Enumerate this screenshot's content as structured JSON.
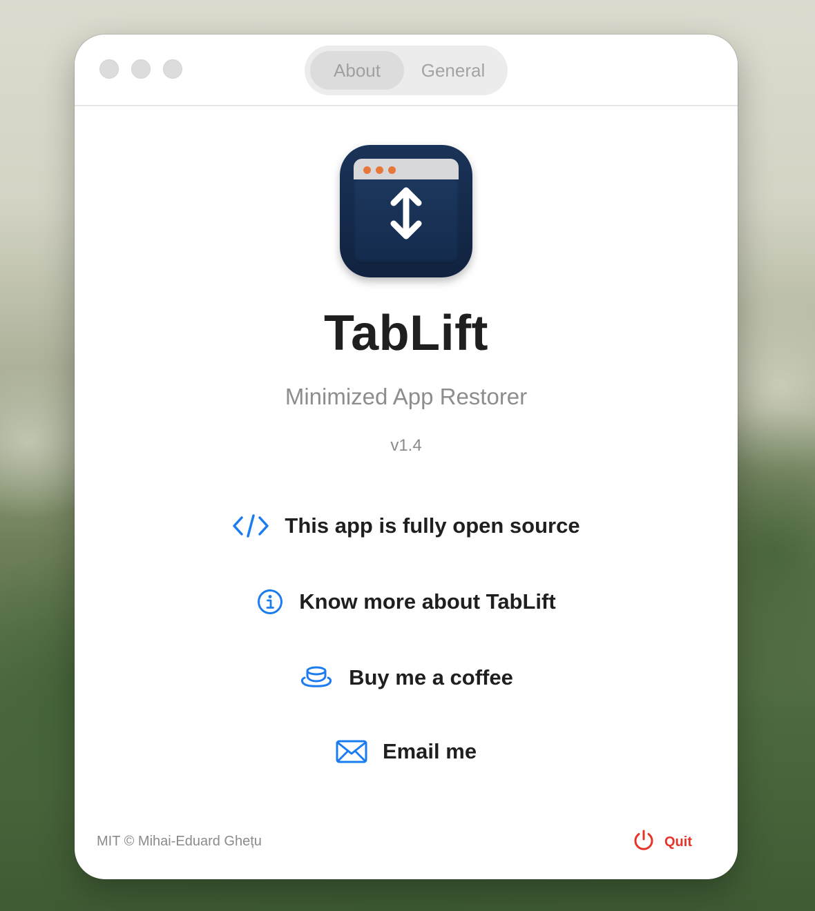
{
  "tabs": [
    {
      "label": "About",
      "selected": true
    },
    {
      "label": "General",
      "selected": false
    }
  ],
  "app": {
    "name": "TabLift",
    "tagline": "Minimized App Restorer",
    "version": "v1.4",
    "icon": "app-window-up-down-arrow-icon"
  },
  "links": [
    {
      "label": "This app is fully open source",
      "icon": "code-brackets-icon"
    },
    {
      "label": "Know more about TabLift",
      "icon": "info-circle-icon"
    },
    {
      "label": "Buy me a coffee",
      "icon": "coffee-cup-icon"
    },
    {
      "label": "Email me",
      "icon": "envelope-icon"
    }
  ],
  "footer": {
    "license": "MIT © Mihai-Eduard Ghețu",
    "quit_label": "Quit",
    "quit_icon": "power-icon"
  },
  "colors": {
    "accent": "#1a7cf0",
    "quit": "#e5352b",
    "icon_bg": "#142b4c",
    "icon_dots": "#e8783a"
  }
}
